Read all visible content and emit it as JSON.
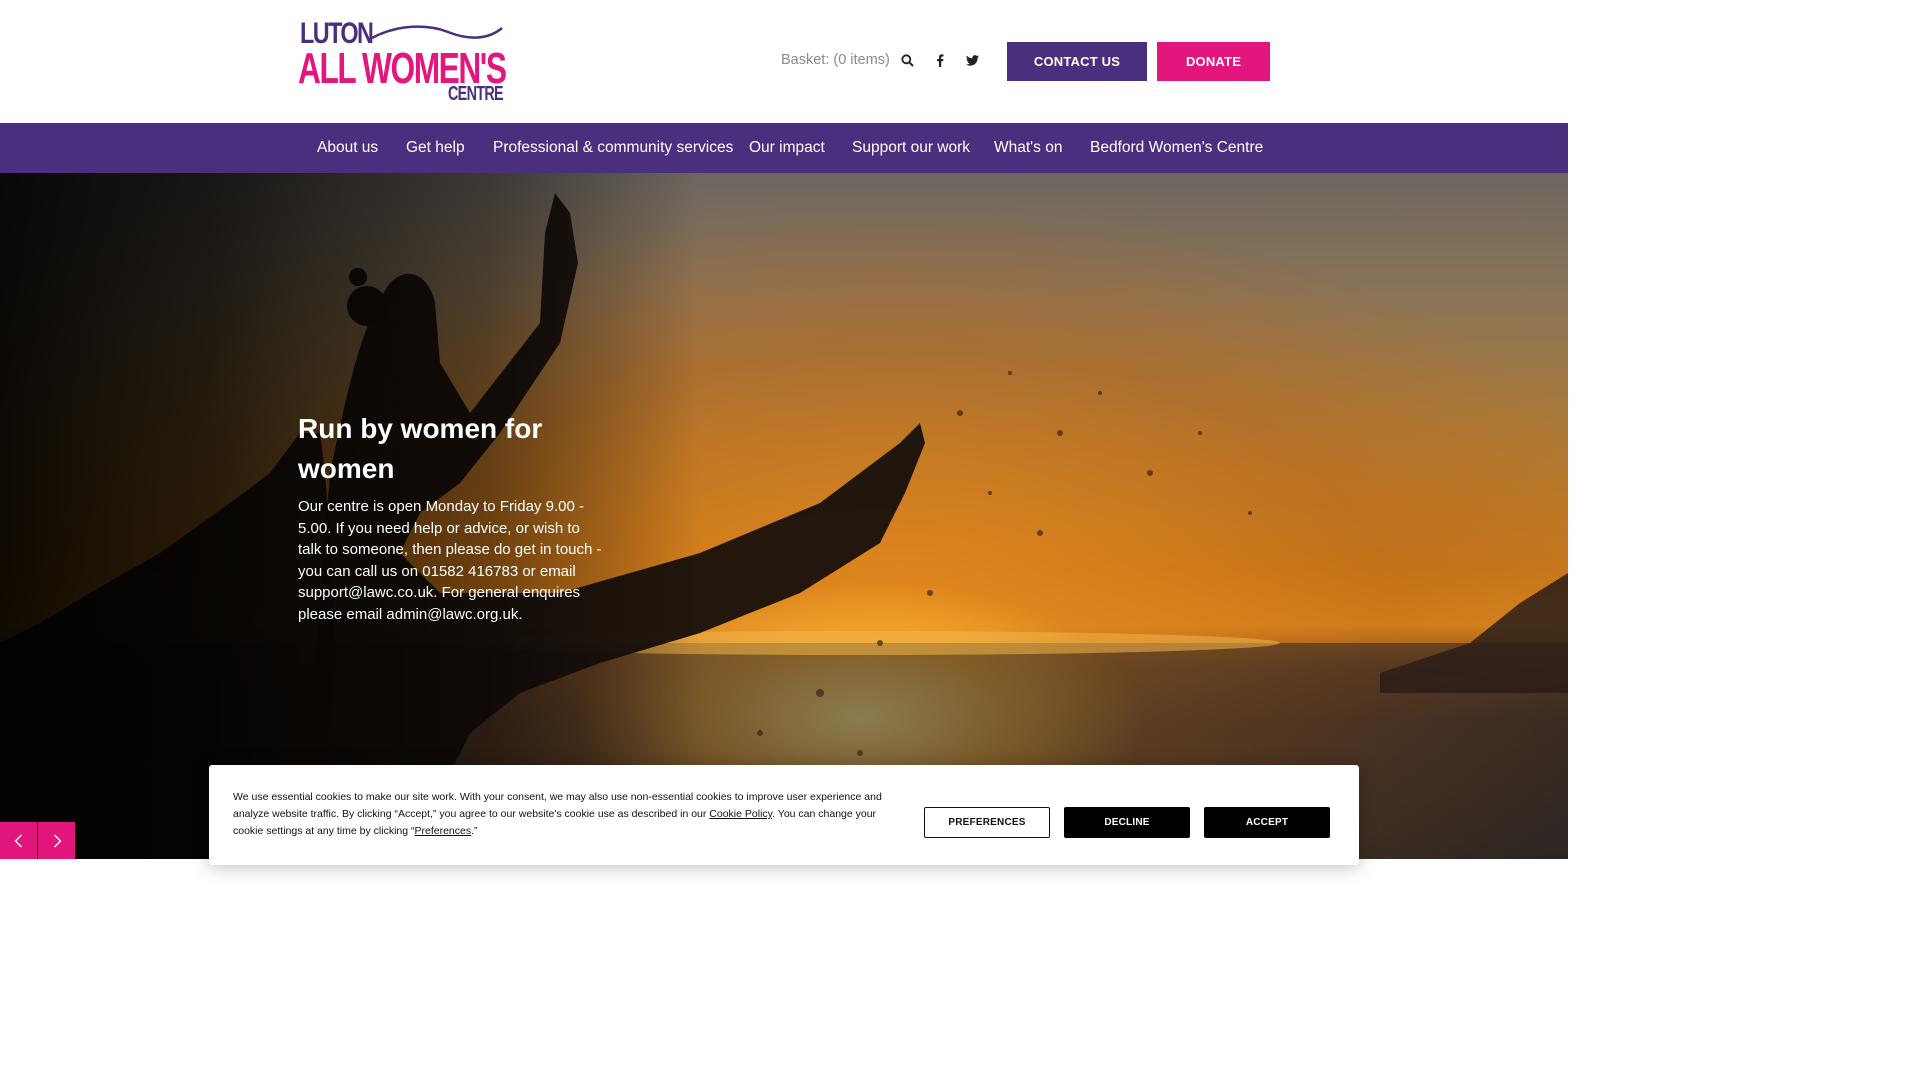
{
  "brand": {
    "logo_line1": "LUTON",
    "logo_line2": "ALL WOMEN'S",
    "logo_line3": "CENTRE",
    "primary_color": "#4a2f7f",
    "accent_color": "#e2167c"
  },
  "header": {
    "basket_label": "Basket: (0 items)",
    "icons": [
      "search-icon",
      "facebook-icon",
      "twitter-icon"
    ],
    "contact_label": "CONTACT US",
    "donate_label": "DONATE"
  },
  "nav": {
    "items": [
      {
        "label": "About us"
      },
      {
        "label": "Get help"
      },
      {
        "label": "Professional & community services"
      },
      {
        "label": "Our impact"
      },
      {
        "label": "Support our work"
      },
      {
        "label": "What's on"
      },
      {
        "label": "Bedford Women's Centre"
      }
    ]
  },
  "hero": {
    "title": "Run by women for women",
    "body": "Our centre is open Monday to Friday 9.00 - 5.00. If you need help or advice, or wish to talk to someone, then please do get in touch - you can call us on 01582 416783 or email support@lawc.co.uk. For general enquires please email admin@lawc.org.uk.",
    "controls": [
      "chevron-left-icon",
      "chevron-right-icon"
    ]
  },
  "cookie": {
    "text_1": "We use essential cookies to make our site work. With your consent, we may also use non-essential cookies to improve user experience and analyze website traffic. By clicking “Accept,” you agree to our website's cookie use as described in our ",
    "cookie_policy_link": "Cookie Policy",
    "text_2": ". You can change your cookie settings at any time by clicking “",
    "preferences_link": "Preferences",
    "text_3": ".”",
    "preferences_label": "PREFERENCES",
    "decline_label": "DECLINE",
    "accept_label": "ACCEPT"
  }
}
